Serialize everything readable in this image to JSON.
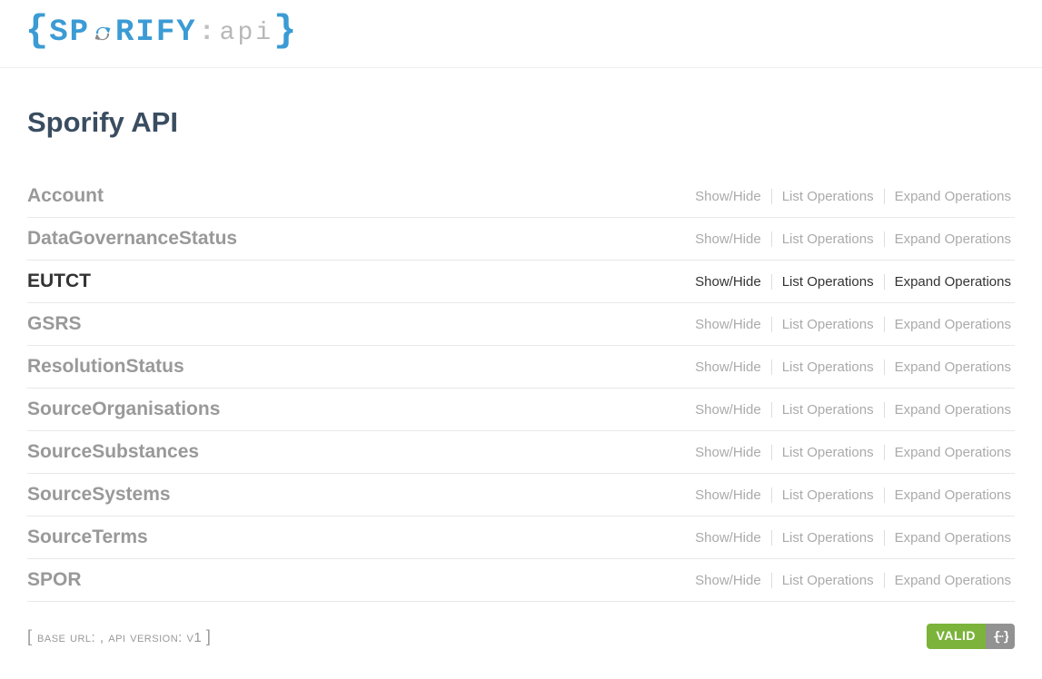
{
  "logo": {
    "brand_left": "SP",
    "brand_right": "RIFY",
    "api_text": "api"
  },
  "page_title": "Sporify API",
  "actions": {
    "show_hide": "Show/Hide",
    "list_operations": "List Operations",
    "expand_operations": "Expand Operations"
  },
  "resources": [
    {
      "name": "Account",
      "active": false
    },
    {
      "name": "DataGovernanceStatus",
      "active": false
    },
    {
      "name": "EUTCT",
      "active": true
    },
    {
      "name": "GSRS",
      "active": false
    },
    {
      "name": "ResolutionStatus",
      "active": false
    },
    {
      "name": "SourceOrganisations",
      "active": false
    },
    {
      "name": "SourceSubstances",
      "active": false
    },
    {
      "name": "SourceSystems",
      "active": false
    },
    {
      "name": "SourceTerms",
      "active": false
    },
    {
      "name": "SPOR",
      "active": false
    }
  ],
  "footer": {
    "base_url_label": "BASE URL",
    "base_url_value": "",
    "api_version_label": "API VERSION",
    "api_version_value": "v1",
    "valid_label": "VALID"
  }
}
